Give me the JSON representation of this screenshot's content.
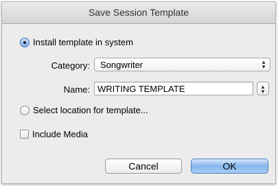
{
  "window": {
    "title": "Save Session Template"
  },
  "options": {
    "install_label": "Install template in system",
    "install_selected": true,
    "select_location_label": "Select location for template...",
    "select_location_selected": false
  },
  "category": {
    "label": "Category:",
    "value": "Songwriter"
  },
  "name": {
    "label": "Name:",
    "value": "WRITING TEMPLATE"
  },
  "include_media": {
    "label": "Include Media",
    "checked": false
  },
  "buttons": {
    "cancel": "Cancel",
    "ok": "OK"
  }
}
